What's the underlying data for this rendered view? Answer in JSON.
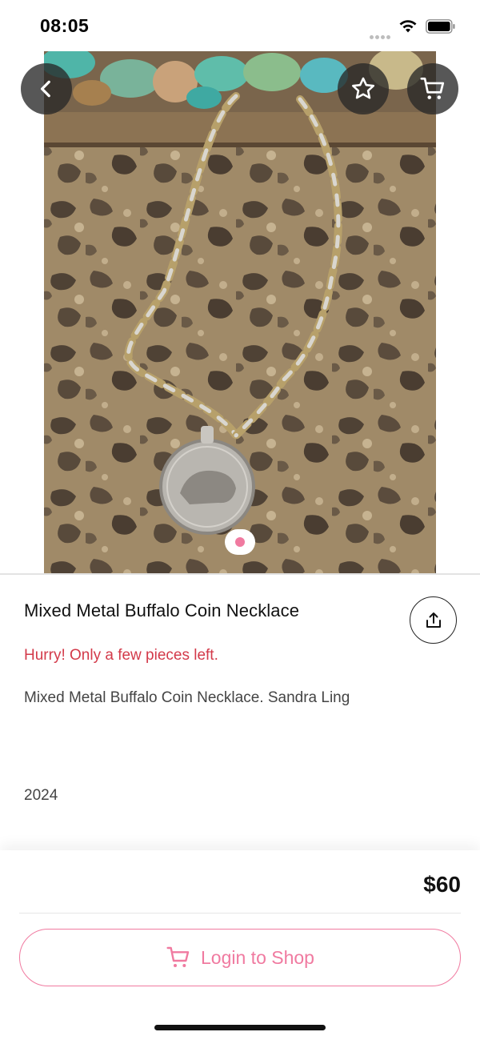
{
  "status_bar": {
    "time": "08:05"
  },
  "gallery": {
    "image_count": 1,
    "current_index": 1
  },
  "top_actions": {
    "back_icon": "chevron-left-icon",
    "favorite_icon": "star-icon",
    "cart_icon": "cart-icon"
  },
  "product": {
    "title": "Mixed Metal Buffalo Coin Necklace",
    "stock_message": "Hurry! Only a few pieces left.",
    "description": "Mixed Metal Buffalo Coin Necklace. Sandra Ling",
    "year": "2024",
    "price": "$60",
    "share_icon": "share-icon"
  },
  "cta": {
    "label": "Login to Shop",
    "icon": "cart-icon"
  },
  "colors": {
    "accent": "#f07aa0",
    "warning": "#d33a4a",
    "text": "#111111"
  }
}
